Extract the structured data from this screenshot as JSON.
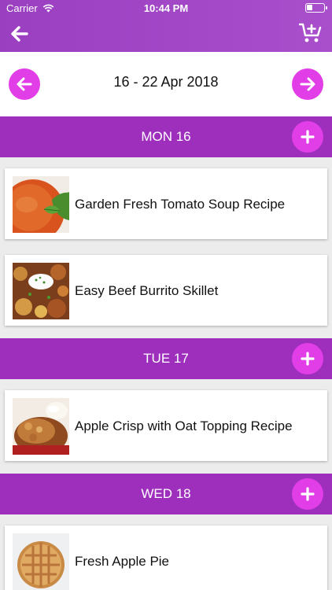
{
  "status_bar": {
    "carrier": "Carrier",
    "time": "10:44 PM"
  },
  "header": {
    "back_icon": "arrow-left-icon",
    "cart_icon": "cart-plus-icon"
  },
  "week": {
    "label": "16 - 22 Apr 2018"
  },
  "days": [
    {
      "label": "MON 16",
      "recipes": [
        {
          "title": "Garden Fresh Tomato Soup Recipe"
        },
        {
          "title": "Easy Beef Burrito Skillet"
        }
      ]
    },
    {
      "label": "TUE 17",
      "recipes": [
        {
          "title": "Apple Crisp with Oat Topping Recipe"
        }
      ]
    },
    {
      "label": "WED 18",
      "recipes": [
        {
          "title": "Fresh Apple Pie"
        }
      ]
    }
  ],
  "colors": {
    "header": "#9e2fbd",
    "accent": "#e23ee8",
    "background": "#ececec"
  }
}
